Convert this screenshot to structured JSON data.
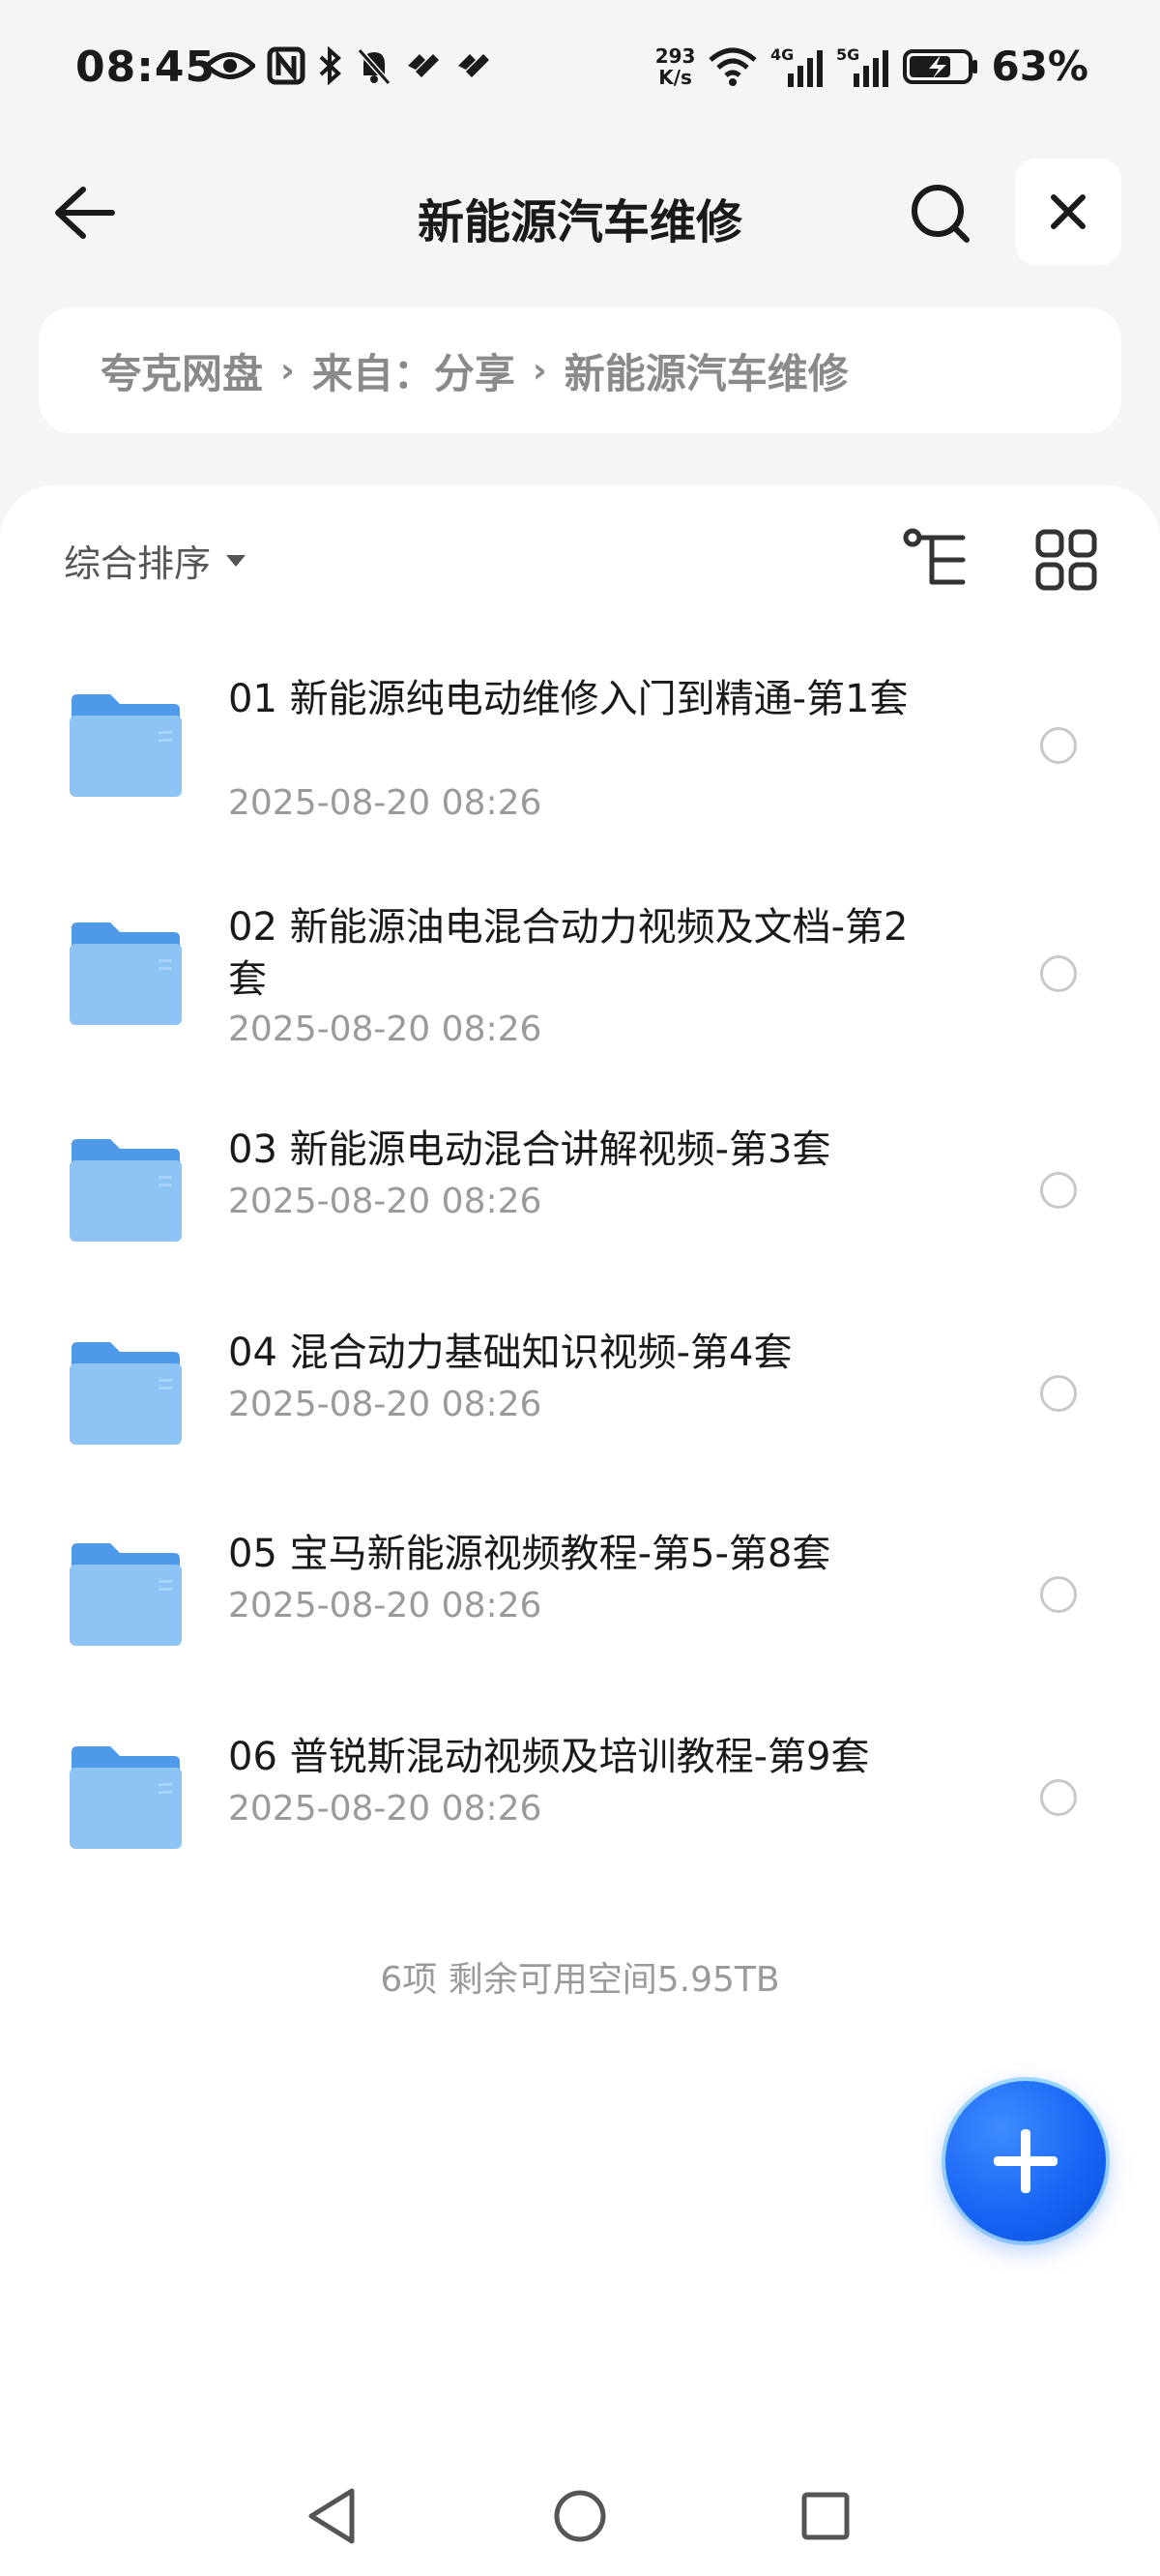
{
  "status_bar": {
    "time": "08:45",
    "net_speed_value": "293",
    "net_speed_unit": "K/s",
    "network_4g": "4G",
    "network_5g": "5G",
    "battery": "63%"
  },
  "header": {
    "title": "新能源汽车维修"
  },
  "breadcrumb": {
    "items": [
      "夸克网盘",
      "来自：分享",
      "新能源汽车维修"
    ],
    "separator": "›"
  },
  "toolbar": {
    "sort_label": "综合排序"
  },
  "files": [
    {
      "name": "01 新能源纯电动维修入门到精通-第1套",
      "date": "2025-08-20 08:26"
    },
    {
      "name": "02 新能源油电混合动力视频及文档-第2套",
      "date": "2025-08-20 08:26"
    },
    {
      "name": "03 新能源电动混合讲解视频-第3套",
      "date": "2025-08-20 08:26"
    },
    {
      "name": "04 混合动力基础知识视频-第4套",
      "date": "2025-08-20 08:26"
    },
    {
      "name": "05 宝马新能源视频教程-第5-第8套",
      "date": "2025-08-20 08:26"
    },
    {
      "name": "06 普锐斯混动视频及培训教程-第9套",
      "date": "2025-08-20 08:26"
    }
  ],
  "summary": "6项 剩余可用空间5.95TB",
  "colors": {
    "accent": "#1663f5",
    "folder": "#6aaef0"
  }
}
